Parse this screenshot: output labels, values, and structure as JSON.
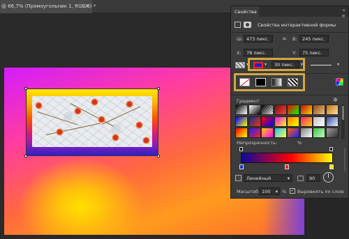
{
  "document": {
    "tab_title": "@ 66,7% (Прямоугольник 1, RGB/8) *",
    "close_glyph": "×"
  },
  "panel": {
    "tab_label": "Свойства",
    "collapse_glyph": "«",
    "menu_glyph": "≡",
    "section_title": "Свойства интерактивной формы",
    "width_label": "Ш:",
    "width_value": "473 пикс.",
    "link_glyph": "∞",
    "height_label": "В:",
    "height_value": "245 пикс.",
    "x_label": "X:",
    "x_value": "78 пикс.",
    "y_label": "Y:",
    "y_value": "75 пикс.",
    "stroke_width": "30 пикс.",
    "gradient_label": "Градиент",
    "gear_glyph": "✲",
    "opacity_label": "Непрозрачность:",
    "opacity_unit": "%",
    "gradient_type": "Линейный",
    "angle_value": "90",
    "scale_label": "Масштаб:",
    "scale_value": "100",
    "scale_unit": "%",
    "align_label": "Выровнять по слою",
    "align_checked": "✓"
  },
  "gradient_presets": [
    [
      "#000000-#ffffff",
      "#ffffff-#000000",
      "#000000-transparent",
      "#7a1010-#ff4040",
      "#ff0000-#00ff00",
      "#c01010-#ffd000",
      "#8a4a1a-#f0c080",
      "#c07010-#ffe0a0"
    ],
    [
      "#0000ff-#ffff00",
      "#0030a0-#ff3000",
      "#ff0000-#0000ff",
      "#ff00ff-#ffff00",
      "#ff8000-#ffff00",
      "#ff2080-#ffd000",
      "#c0c0c0-#ffffff",
      "#3050a0-#f0f0ff"
    ],
    [
      "#ff0000-#ffff00",
      "#2020ff-#ff2020",
      "#ffd000-#ff00ff",
      "#20c0ff-#ffff40",
      "#ff6000-#2020ff",
      "#808080-#ffffff",
      "#40c040-#c0ffc0",
      "#a0a0a0-#303030"
    ]
  ],
  "colors": {
    "accent_highlight": "#d4a640",
    "gradient_bar": "linear-gradient(90deg,#0a0aa0,#ff0000 55%,#ffff00)"
  }
}
